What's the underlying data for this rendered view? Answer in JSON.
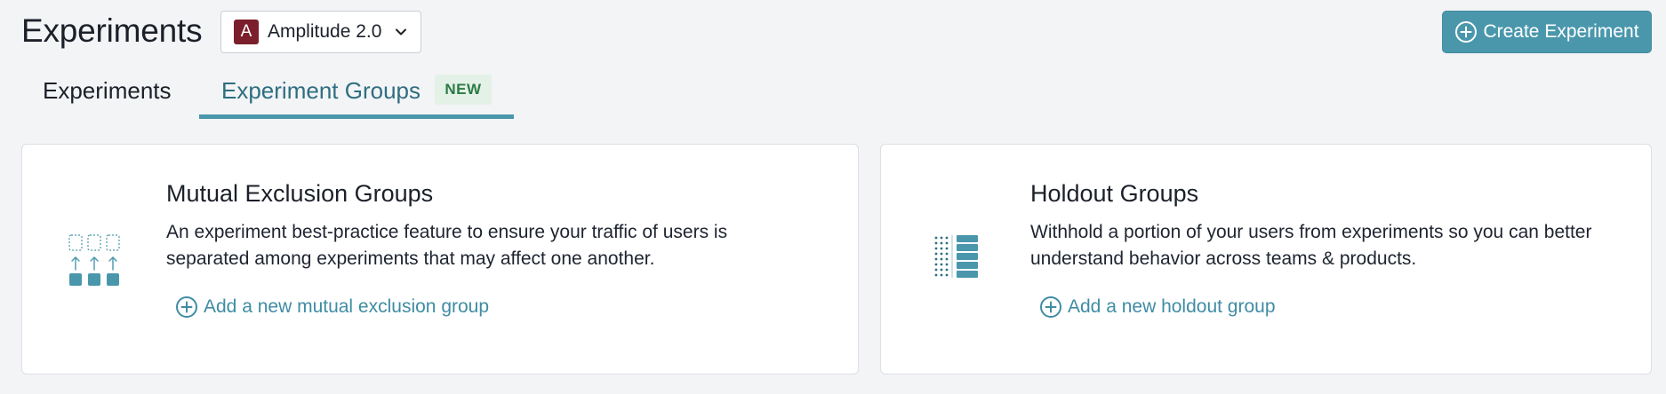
{
  "header": {
    "title": "Experiments",
    "project": {
      "avatar_letter": "A",
      "name": "Amplitude 2.0",
      "avatar_color": "#7b1f2c"
    },
    "create_button_label": "Create Experiment"
  },
  "tabs": [
    {
      "label": "Experiments",
      "active": false
    },
    {
      "label": "Experiment Groups",
      "active": true,
      "badge": "NEW"
    }
  ],
  "cards": [
    {
      "title": "Mutual Exclusion Groups",
      "description": "An experiment best-practice feature to ensure your traffic of users is separated among experiments that may affect one another.",
      "link_label": "Add a new mutual exclusion group",
      "icon": "mutual-exclusion-icon"
    },
    {
      "title": "Holdout Groups",
      "description": "Withhold a portion of your users from experiments so you can better understand behavior across teams & products.",
      "link_label": "Add a new holdout group",
      "icon": "holdout-icon"
    }
  ],
  "colors": {
    "accent": "#4a97ac",
    "link": "#3f8ca3",
    "badge_bg": "#e3f1e7",
    "badge_text": "#2d7a45",
    "background": "#f3f4f6"
  }
}
